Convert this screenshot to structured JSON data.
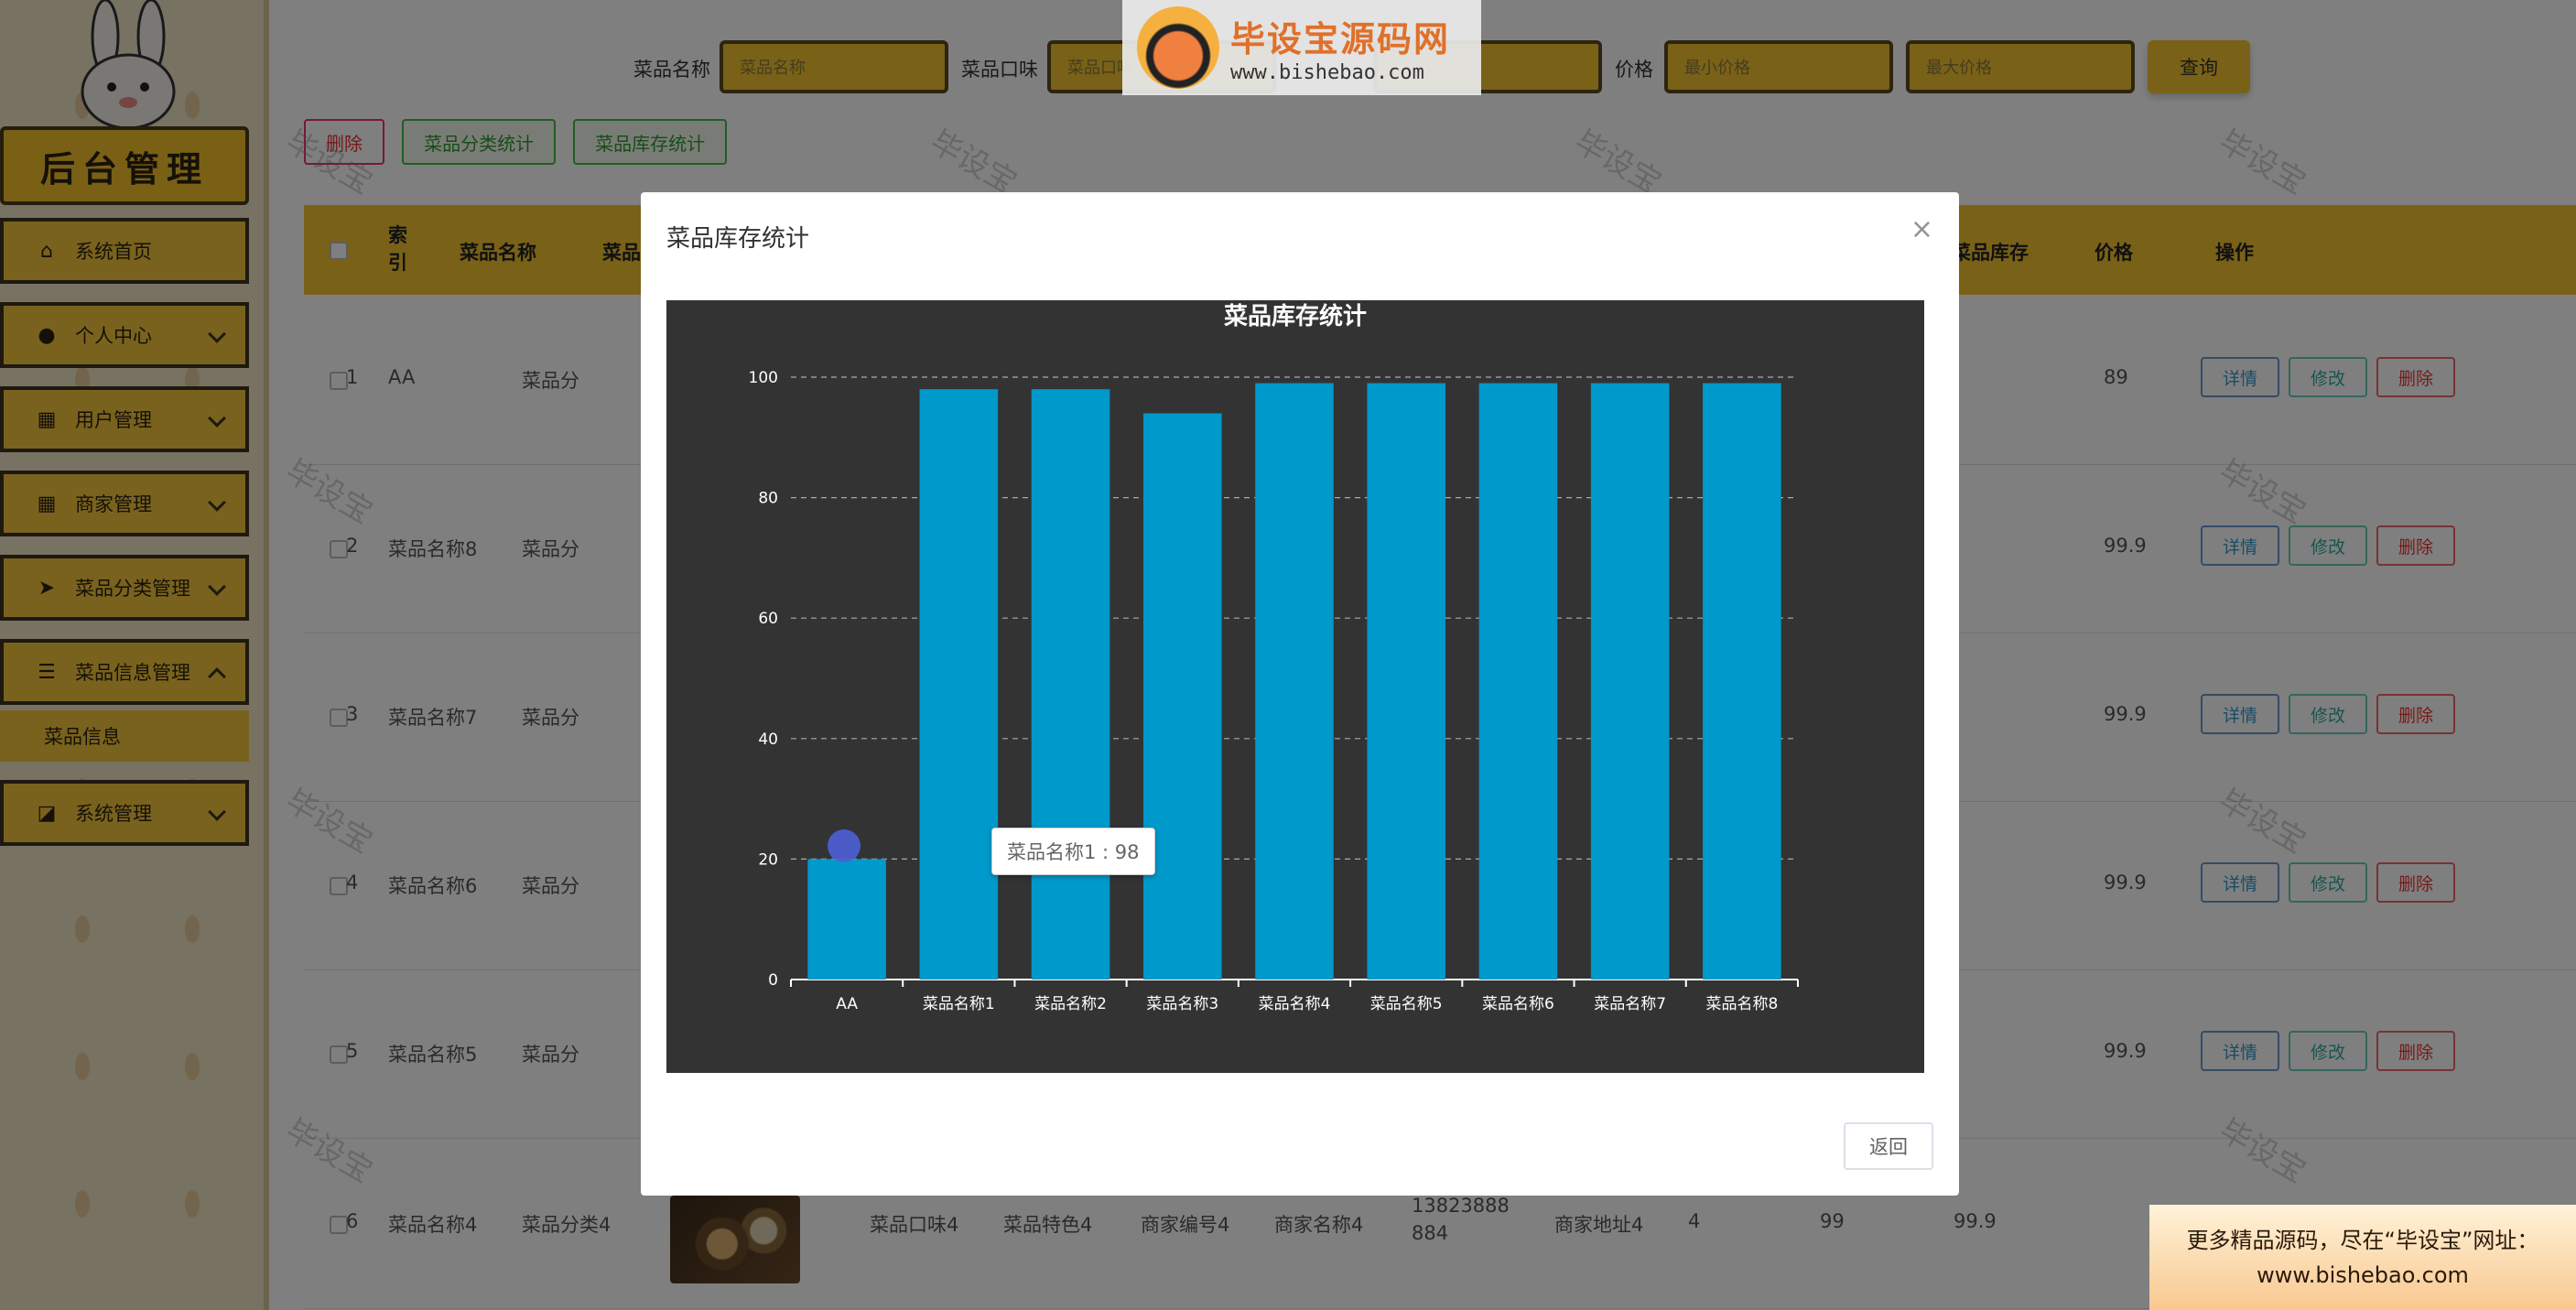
{
  "sidebar": {
    "brand": "后台管理",
    "items": [
      {
        "label": "系统首页",
        "icon": "home-icon",
        "expandable": false
      },
      {
        "label": "个人中心",
        "icon": "user-icon",
        "expandable": true
      },
      {
        "label": "用户管理",
        "icon": "grid-icon",
        "expandable": true
      },
      {
        "label": "商家管理",
        "icon": "grid-icon",
        "expandable": true
      },
      {
        "label": "菜品分类管理",
        "icon": "send-icon",
        "expandable": true
      },
      {
        "label": "菜品信息管理",
        "icon": "list-icon",
        "expandable": true,
        "expanded": true
      },
      {
        "label": "系统管理",
        "icon": "chart-icon",
        "expandable": true
      }
    ],
    "submenu_item": "菜品信息"
  },
  "search": {
    "name_label": "菜品名称",
    "name_placeholder": "菜品名称",
    "taste_label": "菜品口味",
    "taste_placeholder": "菜品口味",
    "price_label": "价格",
    "price_min_placeholder": "最小价格",
    "price_max_placeholder": "最大价格",
    "query_button": "查询"
  },
  "actions": {
    "delete": "删除",
    "category_stats": "菜品分类统计",
    "stock_stats": "菜品库存统计"
  },
  "table": {
    "headers": {
      "index": "索\n引",
      "name": "菜品名称",
      "category": "菜品分",
      "stock": "菜品库存",
      "price": "价格",
      "ops": "操作"
    },
    "rows": [
      {
        "index": "1",
        "name": "AA",
        "category": "菜品分",
        "price": "89"
      },
      {
        "index": "2",
        "name": "菜品名称8",
        "category": "菜品分",
        "price": "99.9"
      },
      {
        "index": "3",
        "name": "菜品名称7",
        "category": "菜品分",
        "price": "99.9"
      },
      {
        "index": "4",
        "name": "菜品名称6",
        "category": "菜品分",
        "price": "99.9"
      },
      {
        "index": "5",
        "name": "菜品名称5",
        "category": "菜品分",
        "price": "99.9"
      }
    ],
    "last_row": {
      "index": "6",
      "name": "菜品名称4",
      "category": "菜品分类4",
      "taste": "菜品口味4",
      "feature": "菜品特色4",
      "merchant_no": "商家编号4",
      "merchant_name": "商家名称4",
      "phone": "13823888884",
      "address": "商家地址4",
      "stock_a": "4",
      "stock": "99",
      "price": "99.9"
    },
    "op_labels": {
      "detail": "详情",
      "edit": "修改",
      "delete": "删除"
    }
  },
  "modal": {
    "title": "菜品库存统计",
    "close_glyph": "×",
    "back_button": "返回",
    "tooltip": "菜品名称1 : 98"
  },
  "watermarks": {
    "repeat_text": "毕设宝",
    "logo_title": "毕设宝源码网",
    "logo_badge": "毕设宝",
    "logo_url": "www.bishebao.com",
    "promo_line1": "更多精品源码，尽在“毕设宝”网址：",
    "promo_line2": "www.bishebao.com"
  },
  "colors": {
    "accent": "#f3c230",
    "bar": "#0099cc",
    "chart_bg": "#333333"
  },
  "chart_data": {
    "type": "bar",
    "title": "菜品库存统计",
    "categories": [
      "AA",
      "菜品名称1",
      "菜品名称2",
      "菜品名称3",
      "菜品名称4",
      "菜品名称5",
      "菜品名称6",
      "菜品名称7",
      "菜品名称8"
    ],
    "values": [
      20,
      98,
      98,
      94,
      99,
      99,
      99,
      99,
      99
    ],
    "yticks": [
      0,
      20,
      40,
      60,
      80,
      100
    ],
    "ylim": [
      0,
      100
    ],
    "grid": true,
    "xlabel": "",
    "ylabel": ""
  }
}
